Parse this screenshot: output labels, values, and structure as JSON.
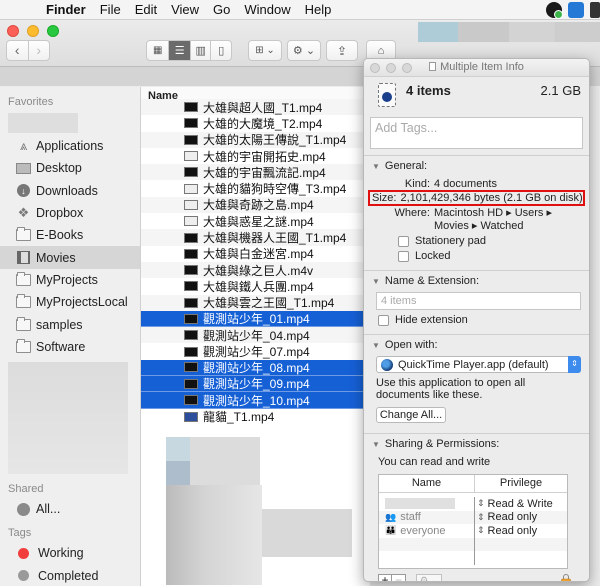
{
  "menubar": {
    "apple": "",
    "items": [
      "Finder",
      "File",
      "Edit",
      "View",
      "Go",
      "Window",
      "Help"
    ]
  },
  "toolbar": {
    "back": "‹",
    "forward": "›",
    "view_icon": "▦",
    "view_list": "☰",
    "view_columns": "▥",
    "view_coverflow": "▯",
    "arrange": "⊞ ⌄",
    "action": "⚙ ⌄",
    "share": "⇪",
    "tag": "⌂"
  },
  "sidebar": {
    "favorites_header": "Favorites",
    "favorites": [
      {
        "label": "Applications",
        "icon": "applications-icon"
      },
      {
        "label": "Desktop",
        "icon": "desktop-icon"
      },
      {
        "label": "Downloads",
        "icon": "downloads-icon"
      },
      {
        "label": "Dropbox",
        "icon": "dropbox-icon"
      },
      {
        "label": "E-Books",
        "icon": "folder-icon"
      },
      {
        "label": "Movies",
        "icon": "movies-icon",
        "active": true
      },
      {
        "label": "MyProjects",
        "icon": "folder-icon"
      },
      {
        "label": "MyProjectsLocal",
        "icon": "folder-icon"
      },
      {
        "label": "samples",
        "icon": "folder-icon"
      },
      {
        "label": "Software",
        "icon": "folder-icon"
      }
    ],
    "shared_header": "Shared",
    "shared": [
      {
        "label": "All...",
        "icon": "network-icon"
      }
    ],
    "tags_header": "Tags",
    "tags": [
      {
        "label": "Working",
        "color": "#f23d3d"
      },
      {
        "label": "Completed",
        "color": "#9a9a9a"
      }
    ]
  },
  "filelist": {
    "column_name": "Name",
    "rows": [
      {
        "name": "大雄與超人國_T1.mp4",
        "selected": false,
        "thumb": "dark"
      },
      {
        "name": "大雄的大魔境_T2.mp4",
        "selected": false,
        "thumb": "dark"
      },
      {
        "name": "大雄的太陽王傳說_T1.mp4",
        "selected": false,
        "thumb": "dark"
      },
      {
        "name": "大雄的宇宙開拓史.mp4",
        "selected": false,
        "thumb": "light"
      },
      {
        "name": "大雄的宇宙飄流記.mp4",
        "selected": false,
        "thumb": "dark"
      },
      {
        "name": "大雄的貓狗時空傳_T3.mp4",
        "selected": false,
        "thumb": "light"
      },
      {
        "name": "大雄與奇跡之島.mp4",
        "selected": false,
        "thumb": "light"
      },
      {
        "name": "大雄與惑星之謎.mp4",
        "selected": false,
        "thumb": "light"
      },
      {
        "name": "大雄與機器人王國_T1.mp4",
        "selected": false,
        "thumb": "dark"
      },
      {
        "name": "大雄與白金迷宮.mp4",
        "selected": false,
        "thumb": "dark"
      },
      {
        "name": "大雄與綠之巨人.m4v",
        "selected": false,
        "thumb": "dark"
      },
      {
        "name": "大雄與鐵人兵團.mp4",
        "selected": false,
        "thumb": "dark"
      },
      {
        "name": "大雄與雲之王國_T1.mp4",
        "selected": false,
        "thumb": "dark"
      },
      {
        "name": "觀測站少年_01.mp4",
        "selected": true,
        "thumb": "dark"
      },
      {
        "name": "觀測站少年_04.mp4",
        "selected": false,
        "thumb": "dark"
      },
      {
        "name": "觀測站少年_07.mp4",
        "selected": false,
        "thumb": "dark"
      },
      {
        "name": "觀測站少年_08.mp4",
        "selected": true,
        "thumb": "dark"
      },
      {
        "name": "觀測站少年_09.mp4",
        "selected": true,
        "thumb": "dark"
      },
      {
        "name": "觀測站少年_10.mp4",
        "selected": true,
        "thumb": "dark"
      },
      {
        "name": "龍貓_T1.mp4",
        "selected": false,
        "thumb": "blue"
      }
    ]
  },
  "info": {
    "window_title": "Multiple Item Info",
    "title": "4 items",
    "total_size": "2.1 GB",
    "tags_placeholder": "Add Tags...",
    "general": {
      "header": "General:",
      "kind_label": "Kind:",
      "kind_value": "4 documents",
      "size_label": "Size:",
      "size_value": "2,101,429,346 bytes (2.1 GB on disk)",
      "where_label": "Where:",
      "where_line1": "Macintosh HD ▸ Users ▸",
      "where_line2": "Movies ▸ Watched",
      "stationery": "Stationery pad",
      "locked": "Locked"
    },
    "name_ext": {
      "header": "Name & Extension:",
      "name_placeholder": "4 items",
      "hide_extension": "Hide extension"
    },
    "open_with": {
      "header": "Open with:",
      "app": "QuickTime Player.app (default)",
      "note": "Use this application to open all documents like these.",
      "change_all": "Change All..."
    },
    "sharing": {
      "header": "Sharing & Permissions:",
      "summary": "You can read and write",
      "col_name": "Name",
      "col_privilege": "Privilege",
      "rows": [
        {
          "name": "",
          "privilege": "Read & Write",
          "icon": "user-icon"
        },
        {
          "name": "staff",
          "privilege": "Read only",
          "icon": "group-icon"
        },
        {
          "name": "everyone",
          "privilege": "Read only",
          "icon": "everyone-icon"
        }
      ],
      "add": "+",
      "remove": "−",
      "action": "⚙ ⌄"
    }
  },
  "colors": {
    "selection": "#1660d6",
    "highlight_box": "#e01010",
    "popup_accent": "#3d8bec"
  }
}
